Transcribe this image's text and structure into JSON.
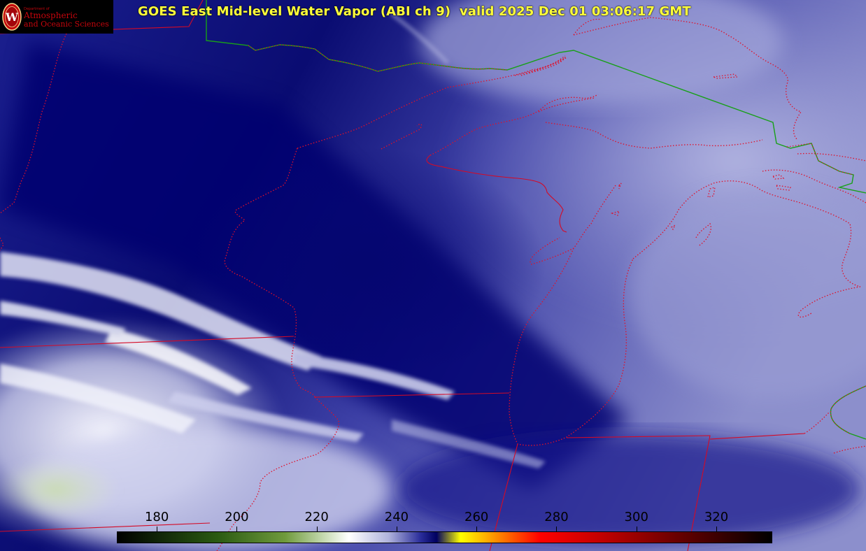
{
  "title": "GOES East Mid-level Water Vapor (ABI ch 9)  valid 2025 Dec 01 03:06:17 GMT",
  "logo": {
    "dept": "Department of",
    "line1": "Atmospheric",
    "line2": "and Oceanic Sciences",
    "mark": "W"
  },
  "colorbar": {
    "min": 170,
    "max": 334,
    "ticks": [
      180,
      200,
      220,
      240,
      260,
      280,
      300,
      320
    ],
    "stops": [
      {
        "value": 170,
        "color": "#000000"
      },
      {
        "value": 195,
        "color": "#2a5a12"
      },
      {
        "value": 212,
        "color": "#6f9a3c"
      },
      {
        "value": 222,
        "color": "#c8dcb4"
      },
      {
        "value": 228,
        "color": "#ffffff"
      },
      {
        "value": 238,
        "color": "#b0b3dc"
      },
      {
        "value": 246,
        "color": "#2a2d9a"
      },
      {
        "value": 250,
        "color": "#000060"
      },
      {
        "value": 256,
        "color": "#ffff00"
      },
      {
        "value": 262,
        "color": "#ffb400"
      },
      {
        "value": 270,
        "color": "#ff4a00"
      },
      {
        "value": 276,
        "color": "#ff0000"
      },
      {
        "value": 290,
        "color": "#c80000"
      },
      {
        "value": 310,
        "color": "#6a0000"
      },
      {
        "value": 334,
        "color": "#000000"
      }
    ]
  },
  "colors": {
    "state_border": "#e0102a",
    "country_border": "#18a018",
    "title_text": "#ffff3a",
    "dry_air": "#07086a",
    "cloud": "#ffffff"
  },
  "legend": {
    "units": ""
  }
}
